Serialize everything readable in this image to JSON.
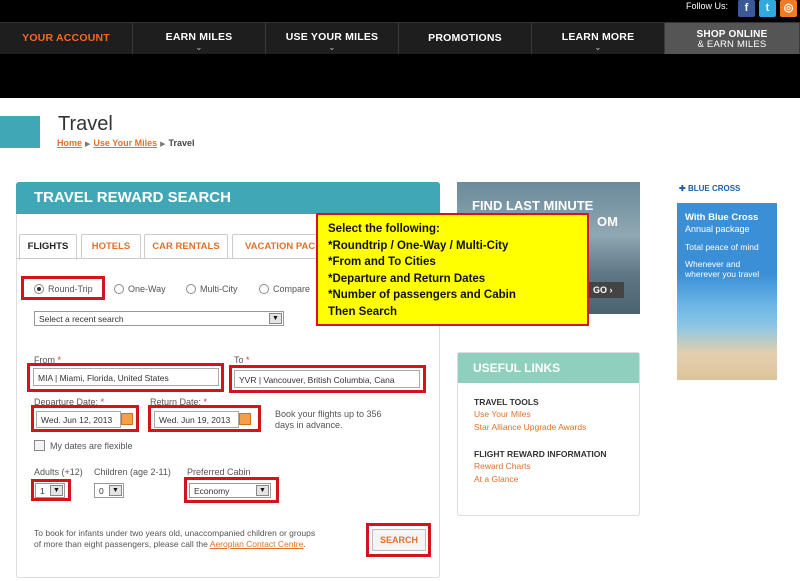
{
  "header": {
    "follow_label": "Follow Us:",
    "social": [
      {
        "icon": "facebook-icon",
        "glyph": "f",
        "color": "#3b5998"
      },
      {
        "icon": "twitter-icon",
        "glyph": "t",
        "color": "#2fa9e0"
      },
      {
        "icon": "rss-icon",
        "glyph": "r",
        "color": "#f27a20"
      }
    ],
    "nav": [
      {
        "label": "YOUR ACCOUNT"
      },
      {
        "label": "EARN MILES"
      },
      {
        "label": "USE YOUR MILES"
      },
      {
        "label": "PROMOTIONS"
      },
      {
        "label": "LEARN MORE"
      }
    ],
    "shop": {
      "line1": "SHOP ONLINE",
      "line2": "& EARN MILES"
    },
    "active_color": "#f26a21"
  },
  "page": {
    "title": "Travel",
    "breadcrumb": [
      "Home",
      "Use Your Miles",
      "Travel"
    ]
  },
  "search": {
    "heading": "TRAVEL REWARD SEARCH",
    "tabs": [
      "FLIGHTS",
      "HOTELS",
      "CAR RENTALS",
      "VACATION PAC"
    ],
    "trip_types": [
      "Round-Trip",
      "One-Way",
      "Multi-City",
      "Compare"
    ],
    "recent_search_placeholder": "Select a recent search",
    "from_label": "From",
    "from_value": "MIA | Miami, Florida, United States",
    "to_label": "To",
    "to_value": "YVR | Vancouver, British Columbia, Cana",
    "departure_label": "Departure Date:",
    "departure_value": "Wed. Jun 12, 2013",
    "return_label": "Return Date:",
    "return_value": "Wed. Jun 19, 2013",
    "booking_hint": "Book your flights up to 356 days in advance.",
    "flexible_label": "My dates are flexible",
    "adults_label": "Adults (+12)",
    "adults_value": "1",
    "children_label": "Children (age 2-11)",
    "children_value": "0",
    "cabin_label": "Preferred Cabin",
    "cabin_value": "Economy",
    "note_text": "To book for infants under two years old, unaccompanied children or groups of more than eight passengers, please call the ",
    "note_link": "Aeroplan Contact Centre",
    "note_end": ".",
    "search_label": "SEARCH"
  },
  "callout": {
    "lines": [
      "Select the following:",
      "*Roundtrip / One-Way / Multi-City",
      "*From and To Cities",
      "*Departure and Return Dates",
      "*Number of passengers and Cabin",
      "Then Search"
    ],
    "bg": "#ffff00",
    "border": "#d4141c"
  },
  "promo": {
    "title": "FIND LAST MINUTE",
    "title_tail": "OM",
    "go": "GO"
  },
  "useful_links": {
    "heading": "USEFUL LINKS",
    "groups": [
      {
        "title": "TRAVEL TOOLS",
        "links": [
          "Use Your Miles",
          "Star Alliance Upgrade Awards"
        ]
      },
      {
        "title": "FLIGHT REWARD INFORMATION",
        "links": [
          "Reward Charts",
          "At a Glance"
        ]
      }
    ]
  },
  "ad": {
    "logo": "BLUE CROSS",
    "line1": "With Blue Cross",
    "line2": "Annual package",
    "line3": "Total peace of mind",
    "line4": "Whenever and wherever you travel"
  }
}
